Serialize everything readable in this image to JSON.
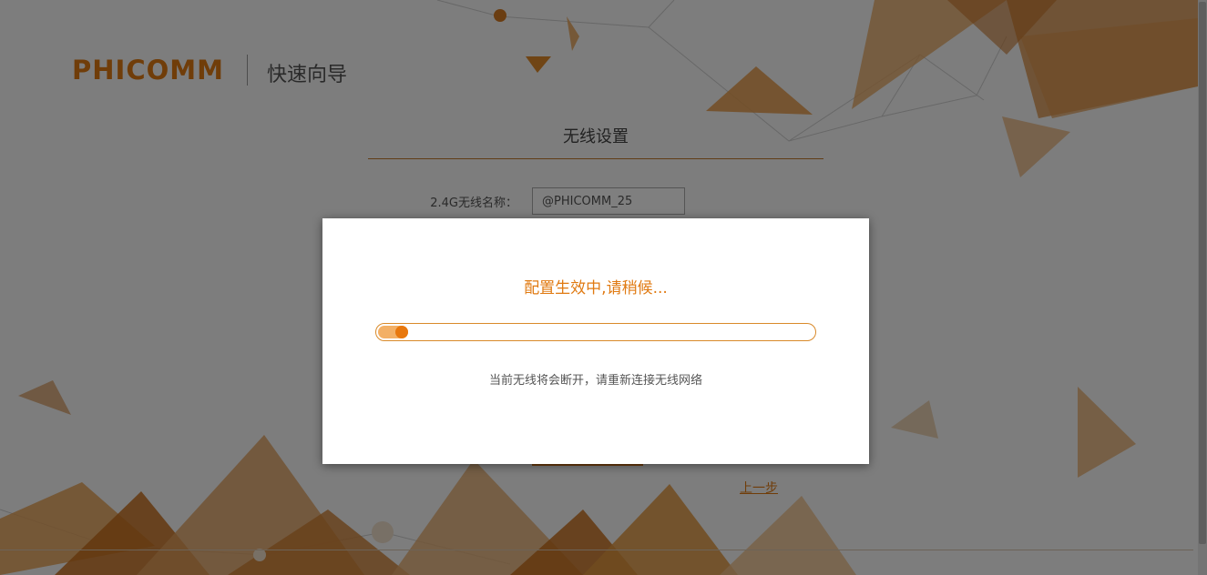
{
  "header": {
    "brand": "PHICOMM",
    "wizard_title": "快速向导"
  },
  "section": {
    "title": "无线设置"
  },
  "form": {
    "ssid_24g_label": "2.4G无线名称：",
    "ssid_24g_value": "@PHICOMM_25"
  },
  "nav": {
    "prev_label": "上一步"
  },
  "modal": {
    "title": "配置生效中,请稍候...",
    "progress_percent": 7,
    "note": "当前无线将会断开，请重新连接无线网络"
  },
  "colors": {
    "accent": "#e07a12",
    "progress_fill": "#f3b066",
    "progress_knob": "#e8780e"
  }
}
